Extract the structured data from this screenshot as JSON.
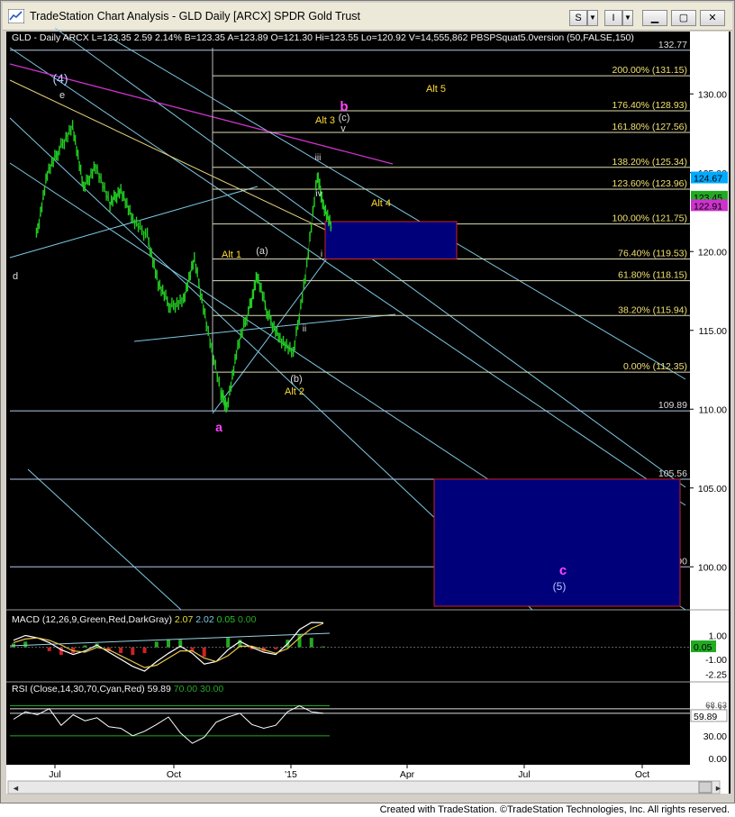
{
  "window": {
    "title": "TradeStation Chart Analysis - GLD Daily [ARCX] SPDR Gold Trust",
    "buttons": [
      "S",
      "I"
    ]
  },
  "header": {
    "text": "GLD - Daily  ARCX  L=123.35  2.59  2.14%  B=123.35  A=123.89  O=121.30  Hi=123.55  Lo=120.92  V=14,555,862  PBSPSquat5.0version (50,FALSE,150)"
  },
  "macd_header": {
    "prefix": "MACD (12,26,9,Green,Red,DarkGray)",
    "v1": "2.07",
    "v2": "2.02",
    "v3": "0.05",
    "v4": "0.00"
  },
  "rsi_header": {
    "prefix": "RSI (Close,14,30,70,Cyan,Red)",
    "v1": "59.89",
    "v2": "70.00",
    "v3": "30.00"
  },
  "credit": "Created with TradeStation. ©TradeStation Technologies, Inc. All rights reserved.",
  "colors": {
    "background": "#000000",
    "price": "#22cc22",
    "fib": "#dcdcb4",
    "channel": "#7ec8e3",
    "magenta": "#cc33cc",
    "box": "#00007a"
  },
  "chart_data": [
    {
      "type": "line",
      "title": "GLD - Daily",
      "y_axis_ticks": [
        "130.00",
        "125.00",
        "120.00",
        "115.00",
        "110.00",
        "105.00",
        "100.00"
      ],
      "x_axis_ticks": [
        "Jul",
        "Oct",
        "'15",
        "Apr",
        "Jul",
        "Oct"
      ],
      "ylim": [
        97.5,
        133.5
      ],
      "series": [
        {
          "x": [
            "2014-06-01",
            "2014-06-10",
            "2014-06-20",
            "2014-07-01",
            "2014-07-10",
            "2014-07-20",
            "2014-08-01",
            "2014-08-10",
            "2014-08-20",
            "2014-09-01",
            "2014-09-10",
            "2014-09-20",
            "2014-10-01",
            "2014-10-10",
            "2014-10-20",
            "2014-11-01",
            "2014-11-06",
            "2014-11-15",
            "2014-11-25",
            "2014-12-01",
            "2014-12-10",
            "2014-12-20",
            "2014-12-31",
            "2015-01-10",
            "2015-01-20",
            "2015-01-25",
            "2015-02-01"
          ],
          "values": [
            121,
            125,
            126.5,
            128,
            124,
            125.5,
            123,
            124,
            122,
            121,
            118,
            116.5,
            117,
            119.5,
            115.5,
            111,
            110.2,
            114,
            116.5,
            118.5,
            116,
            114.5,
            113.5,
            118.5,
            124.8,
            123,
            121.5
          ]
        }
      ],
      "price_levels": [
        {
          "label": "132.77",
          "value": 132.77
        },
        {
          "label": "200.00% (131.15)",
          "value": 131.15
        },
        {
          "label": "176.40% (128.93)",
          "value": 128.93
        },
        {
          "label": "161.80% (127.56)",
          "value": 127.56
        },
        {
          "label": "138.20% (125.34)",
          "value": 125.34
        },
        {
          "label": "123.60% (123.96)",
          "value": 123.96
        },
        {
          "label": "100.00% (121.75)",
          "value": 121.75
        },
        {
          "label": "76.40% (119.53)",
          "value": 119.53
        },
        {
          "label": "61.80% (118.15)",
          "value": 118.15
        },
        {
          "label": "38.20% (115.94)",
          "value": 115.94
        },
        {
          "label": "0.00% (112.35)",
          "value": 112.35
        },
        {
          "label": "109.89",
          "value": 109.89
        },
        {
          "label": "105.56",
          "value": 105.56
        },
        {
          "label": "100.00",
          "value": 100.0
        }
      ],
      "price_tags": [
        {
          "label": "124.67",
          "value": 124.67,
          "bg": "#00aaff"
        },
        {
          "label": "123.45",
          "value": 123.45,
          "bg": "#22aa22"
        },
        {
          "label": "122.91",
          "value": 122.91,
          "bg": "#cc33cc"
        }
      ],
      "annotations": [
        {
          "text": "(4)",
          "color": "#b4c8ff"
        },
        {
          "text": "e",
          "color": "#dddddd"
        },
        {
          "text": "d",
          "color": "#dddddd"
        },
        {
          "text": "b",
          "color": "#ff44ff"
        },
        {
          "text": "Alt 3",
          "color": "#ffdd33"
        },
        {
          "text": "(c)",
          "color": "#dddddd"
        },
        {
          "text": "v",
          "color": "#dddddd"
        },
        {
          "text": "iii",
          "color": "#dddddd"
        },
        {
          "text": "iv",
          "color": "#dddddd"
        },
        {
          "text": "ii",
          "color": "#dddddd"
        },
        {
          "text": "i",
          "color": "#dddddd"
        },
        {
          "text": "Alt 5",
          "color": "#ffdd33"
        },
        {
          "text": "Alt 4",
          "color": "#ffdd33"
        },
        {
          "text": "Alt 1",
          "color": "#ffdd33"
        },
        {
          "text": "(a)",
          "color": "#dddddd"
        },
        {
          "text": "(b)",
          "color": "#dddddd"
        },
        {
          "text": "Alt 2",
          "color": "#ffdd33"
        },
        {
          "text": "a",
          "color": "#ff44ff"
        },
        {
          "text": "c",
          "color": "#ff44ff"
        },
        {
          "text": "(5)",
          "color": "#b4c8ff"
        }
      ]
    },
    {
      "type": "line",
      "title": "MACD (12,26,9,Green,Red,DarkGray)",
      "y_axis_ticks": [
        "1.00",
        "-1.00",
        "-2.25"
      ],
      "ylim": [
        -2.6,
        2.4
      ],
      "series": [
        {
          "name": "MACD",
          "values": [
            0.6,
            1.0,
            0.8,
            0.4,
            -0.2,
            -0.6,
            -0.3,
            0.2,
            -0.4,
            -1.0,
            -1.6,
            -2.0,
            -1.2,
            -0.5,
            0.1,
            -0.5,
            -1.4,
            -1.2,
            -0.2,
            0.5,
            0.0,
            -0.4,
            -0.6,
            0.3,
            1.5,
            2.1,
            2.07
          ]
        },
        {
          "name": "Signal",
          "values": [
            0.4,
            0.7,
            0.8,
            0.6,
            0.2,
            -0.3,
            -0.4,
            0.0,
            -0.2,
            -0.7,
            -1.2,
            -1.7,
            -1.5,
            -0.9,
            -0.3,
            -0.3,
            -0.9,
            -1.2,
            -0.7,
            0.1,
            0.1,
            -0.2,
            -0.5,
            -0.1,
            0.8,
            1.6,
            2.02
          ]
        }
      ],
      "tags": [
        {
          "label": "0.05",
          "value": 0.05,
          "bg": "#22aa22"
        }
      ]
    },
    {
      "type": "line",
      "title": "RSI (Close,14,30,70,Cyan,Red)",
      "y_axis_ticks": [
        "60.00",
        "30.00",
        "0.00"
      ],
      "ylim": [
        -5,
        85
      ],
      "series": [
        {
          "name": "RSI",
          "values": [
            52,
            62,
            58,
            66,
            44,
            58,
            50,
            54,
            42,
            40,
            30,
            36,
            45,
            55,
            34,
            20,
            28,
            48,
            55,
            60,
            45,
            40,
            44,
            62,
            70,
            62,
            59.89
          ]
        }
      ],
      "tags": [
        {
          "label": "59.89",
          "value": 59.89,
          "bg": "#ffffff"
        }
      ],
      "text_labels": [
        "68.63",
        "71.37"
      ]
    }
  ]
}
